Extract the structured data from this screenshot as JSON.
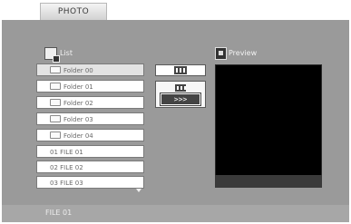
{
  "tab": {
    "label": "PHOTO"
  },
  "list_panel": {
    "label": "List"
  },
  "preview_panel": {
    "label": "Preview"
  },
  "items": [
    {
      "label": "Folder 00",
      "type": "folder",
      "selected": true
    },
    {
      "label": "Folder 01",
      "type": "folder",
      "selected": false
    },
    {
      "label": "Folder 02",
      "type": "folder",
      "selected": false
    },
    {
      "label": "Folder 03",
      "type": "folder",
      "selected": false
    },
    {
      "label": "Folder 04",
      "type": "folder",
      "selected": false
    },
    {
      "label": "01 FILE 01",
      "type": "file",
      "selected": false
    },
    {
      "label": "02 FILE 02",
      "type": "file",
      "selected": false
    },
    {
      "label": "03 FILE 03",
      "type": "file",
      "selected": false
    }
  ],
  "controls": {
    "play_icon": "film-strip-icon",
    "slideshow_icon": "film-strip-small-icon",
    "slideshow_label": ">>>"
  },
  "footer": {
    "text": "FILE 01"
  },
  "colors": {
    "panel": "#9a9a9a",
    "footer": "#a7a7a7",
    "preview": "#000000"
  }
}
